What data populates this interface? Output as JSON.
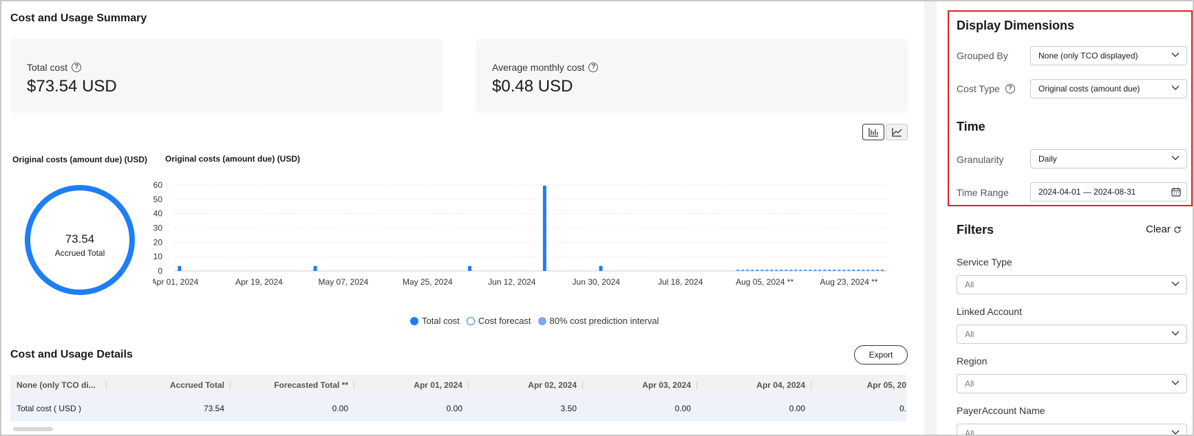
{
  "summary": {
    "title": "Cost and Usage Summary",
    "total_cost_label": "Total cost",
    "total_cost_value": "$73.54 USD",
    "avg_cost_label": "Average monthly cost",
    "avg_cost_value": "$0.48 USD"
  },
  "donut": {
    "caption": "Original costs (amount due) (USD)",
    "value": "73.54",
    "label": "Accrued Total",
    "color": "#1e7ef5"
  },
  "chart_data": {
    "type": "bar",
    "title": "Original costs (amount due) (USD)",
    "xlabel": "",
    "ylabel": "",
    "ylim": [
      0,
      60
    ],
    "yticks": [
      0,
      10,
      20,
      30,
      40,
      50,
      60
    ],
    "date_range": [
      "2024-04-01",
      "2024-08-31"
    ],
    "tick_labels": [
      "Apr 01, 2024",
      "Apr 19, 2024",
      "May 07, 2024",
      "May 25, 2024",
      "Jun 12, 2024",
      "Jun 30, 2024",
      "Jul 18, 2024",
      "Aug 05, 2024 **",
      "Aug 23, 2024 **"
    ],
    "tick_days": [
      0,
      18,
      36,
      54,
      72,
      90,
      108,
      126,
      144
    ],
    "bars": [
      {
        "date": "2024-04-02",
        "value": 3.5
      },
      {
        "date": "2024-05-01",
        "value": 3.5
      },
      {
        "date": "2024-06-03",
        "value": 3.5
      },
      {
        "date": "2024-06-19",
        "value": 59.5
      },
      {
        "date": "2024-07-01",
        "value": 3.5
      }
    ],
    "forecast": {
      "start": "2024-07-30",
      "end": "2024-08-31",
      "value": 0.0
    },
    "grid": true,
    "legend": [
      "Total cost",
      "Cost forecast",
      "80% cost prediction interval"
    ],
    "colors": {
      "total": "#1e7ef5",
      "forecast": "#1e7ef5",
      "interval": "#7fa8f0"
    }
  },
  "details": {
    "title": "Cost and Usage Details",
    "export_label": "Export",
    "columns": [
      "None (only TCO di...",
      "Accrued Total",
      "Forecasted Total **",
      "Apr 01, 2024",
      "Apr 02, 2024",
      "Apr 03, 2024",
      "Apr 04, 2024",
      "Apr 05, 20"
    ],
    "rows": [
      [
        "Total cost ( USD )",
        "73.54",
        "0.00",
        "0.00",
        "3.50",
        "0.00",
        "0.00",
        "0."
      ]
    ]
  },
  "panel": {
    "display_title": "Display Dimensions",
    "grouped_by_label": "Grouped By",
    "grouped_by_value": "None (only TCO displayed)",
    "cost_type_label": "Cost Type",
    "cost_type_value": "Original costs (amount due)",
    "time_title": "Time",
    "granularity_label": "Granularity",
    "granularity_value": "Daily",
    "time_range_label": "Time Range",
    "time_range_value": "2024-04-01 — 2024-08-31",
    "filters_title": "Filters",
    "clear_label": "Clear",
    "service_type_label": "Service Type",
    "service_type_value": "All",
    "linked_account_label": "Linked Account",
    "linked_account_value": "All",
    "region_label": "Region",
    "region_value": "All",
    "payer_label": "PayerAccount Name",
    "payer_value": "All",
    "highlight_color": "#e02020"
  }
}
